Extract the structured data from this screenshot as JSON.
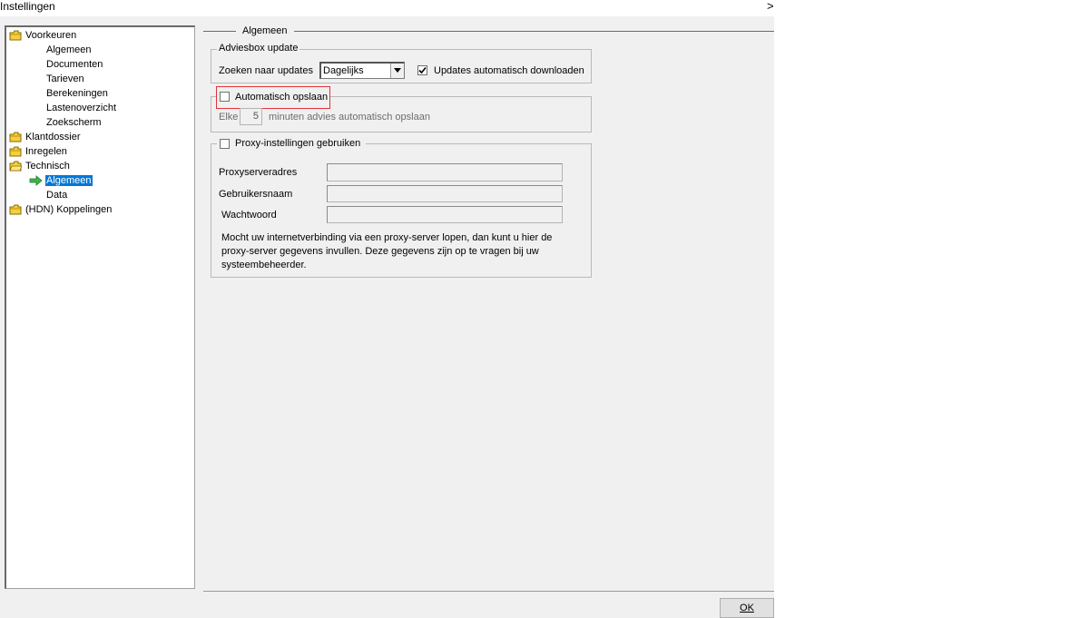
{
  "window": {
    "title": "Instellingen",
    "close_label": ">"
  },
  "tree": {
    "items": [
      {
        "label": "Voorkeuren",
        "icon": "folder-icon"
      },
      {
        "label": "Algemeen"
      },
      {
        "label": "Documenten"
      },
      {
        "label": "Tarieven"
      },
      {
        "label": "Berekeningen"
      },
      {
        "label": "Lastenoverzicht"
      },
      {
        "label": "Zoekscherm"
      },
      {
        "label": "Klantdossier",
        "icon": "folder-icon"
      },
      {
        "label": "Inregelen",
        "icon": "folder-icon"
      },
      {
        "label": "Technisch",
        "icon": "folder-icon"
      },
      {
        "label": "Algemeen",
        "selected": true,
        "icon": "arrow-right-icon"
      },
      {
        "label": "Data"
      },
      {
        "label": "(HDN) Koppelingen",
        "icon": "folder-icon"
      }
    ]
  },
  "main": {
    "section_title": "Algemeen",
    "update_group": {
      "legend": "Adviesbox update",
      "search_label": "Zoeken naar updates",
      "frequency_value": "Dagelijks",
      "auto_download_label": "Updates automatisch downloaden",
      "auto_download_checked": true
    },
    "autosave_group": {
      "checkbox_label": "Automatisch opslaan",
      "checked": false,
      "every_label": "Elke",
      "minutes_value": "5",
      "minutes_suffix": "minuten advies automatisch opslaan"
    },
    "proxy_group": {
      "checkbox_label": "Proxy-instellingen gebruiken",
      "checked": false,
      "address_label": "Proxyserveradres",
      "username_label": "Gebruikersnaam",
      "password_label": "Wachtwoord",
      "info_line1": "Mocht uw internetverbinding via een proxy-server lopen, dan kunt u hier de",
      "info_line2": "proxy-server gegevens invullen. Deze gegevens zijn op te vragen bij uw",
      "info_line3": "systeembeheerder."
    }
  },
  "footer": {
    "ok_label": "OK"
  },
  "colors": {
    "selection": "#0078d7",
    "highlight_border": "#e0333a",
    "folder": "#f5d03c",
    "arrow": "#3cb64a"
  }
}
